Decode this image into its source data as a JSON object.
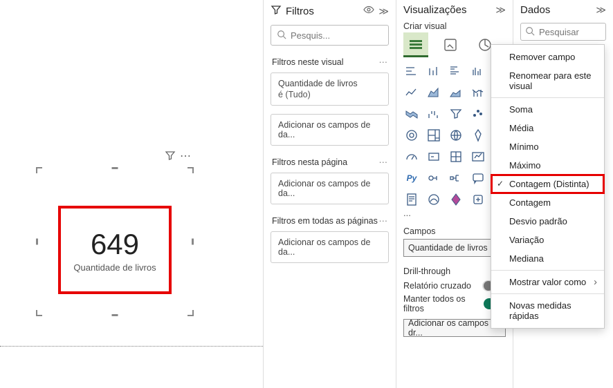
{
  "canvas": {
    "card_value": "649",
    "card_label": "Quantidade de livros"
  },
  "filters": {
    "title": "Filtros",
    "search_placeholder": "Pesquis...",
    "sections": {
      "visual_title": "Filtros neste visual",
      "visual_card_field": "Quantidade de livros",
      "visual_card_status": "é (Tudo)",
      "visual_add": "Adicionar os campos de da...",
      "page_title": "Filtros nesta página",
      "page_add": "Adicionar os campos de da...",
      "all_title": "Filtros em todas as páginas",
      "all_add": "Adicionar os campos de da..."
    }
  },
  "viz": {
    "title": "Visualizações",
    "subtitle": "Criar visual",
    "fields_label": "Campos",
    "field_well": "Quantidade de livros",
    "drill_title": "Drill-through",
    "cross_report": "Relatório cruzado",
    "keep_all": "Manter todos os filtros",
    "drill_well": "Adicionar os campos de dr...",
    "ellipsis": "..."
  },
  "data": {
    "title": "Dados",
    "search_placeholder": "Pesquisar",
    "trailing_ellipsis": "..."
  },
  "context_menu": {
    "items": [
      "Remover campo",
      "Renomear para este visual",
      "Soma",
      "Média",
      "Mínimo",
      "Máximo",
      "Contagem (Distinta)",
      "Contagem",
      "Desvio padrão",
      "Variação",
      "Mediana",
      "Mostrar valor como",
      "Novas medidas rápidas"
    ]
  }
}
